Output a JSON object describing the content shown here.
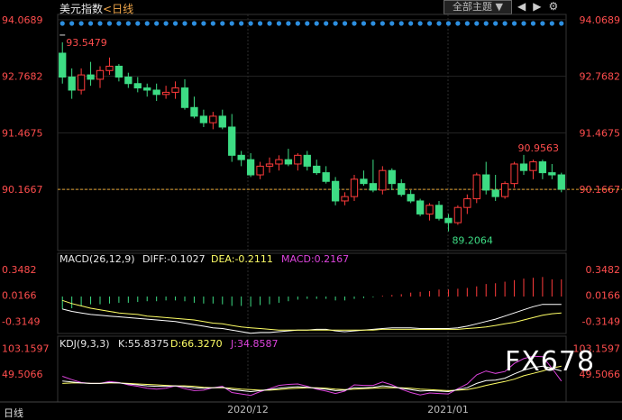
{
  "header": {
    "instrument": "美元指数",
    "period": "<日线",
    "theme_button": "全部主题 ▼",
    "bottom_tab": "日线",
    "watermark": "FX678",
    "nav_prev": "◀",
    "nav_next": "▶",
    "nav_settings": "⚙"
  },
  "chart_data": [
    {
      "type": "candlestick",
      "title": "美元指数",
      "yticks": [
        "94.0689",
        "92.7682",
        "91.4675",
        "90.1667"
      ],
      "ylim": [
        88.8,
        94.15
      ],
      "current_price": 90.1667,
      "annotations": {
        "high": "93.5479",
        "low": "89.2064",
        "recent_high": "90.9563"
      },
      "xticks": [
        "2020/12",
        "2021/01"
      ],
      "colors": {
        "up": "#ff3b3b",
        "down": "#3ddc84",
        "grid": "#2a2a2a",
        "price_line": "#e0a030"
      },
      "candles": [
        [
          93.3,
          93.55,
          92.6,
          92.75
        ],
        [
          92.75,
          92.95,
          92.25,
          92.45
        ],
        [
          92.45,
          92.95,
          92.35,
          92.8
        ],
        [
          92.8,
          93.1,
          92.55,
          92.7
        ],
        [
          92.7,
          93.0,
          92.5,
          92.9
        ],
        [
          92.9,
          93.2,
          92.8,
          93.0
        ],
        [
          93.0,
          93.05,
          92.65,
          92.75
        ],
        [
          92.75,
          92.85,
          92.5,
          92.6
        ],
        [
          92.6,
          92.75,
          92.4,
          92.5
        ],
        [
          92.5,
          92.6,
          92.3,
          92.45
        ],
        [
          92.45,
          92.6,
          92.2,
          92.35
        ],
        [
          92.35,
          92.55,
          92.25,
          92.4
        ],
        [
          92.4,
          92.65,
          92.25,
          92.5
        ],
        [
          92.5,
          92.7,
          92.0,
          92.05
        ],
        [
          92.05,
          92.3,
          91.8,
          91.85
        ],
        [
          91.85,
          92.0,
          91.6,
          91.7
        ],
        [
          91.7,
          91.95,
          91.55,
          91.85
        ],
        [
          91.85,
          92.0,
          91.55,
          91.6
        ],
        [
          91.6,
          91.9,
          90.8,
          90.95
        ],
        [
          90.95,
          91.05,
          90.7,
          90.85
        ],
        [
          90.85,
          91.0,
          90.45,
          90.5
        ],
        [
          90.5,
          90.8,
          90.4,
          90.7
        ],
        [
          90.7,
          90.9,
          90.55,
          90.75
        ],
        [
          90.75,
          90.95,
          90.6,
          90.85
        ],
        [
          90.85,
          91.1,
          90.7,
          90.75
        ],
        [
          90.75,
          91.0,
          90.6,
          90.95
        ],
        [
          90.95,
          91.05,
          90.6,
          90.7
        ],
        [
          90.7,
          90.85,
          90.5,
          90.55
        ],
        [
          90.55,
          90.7,
          90.3,
          90.35
        ],
        [
          90.35,
          90.45,
          89.8,
          89.9
        ],
        [
          89.9,
          90.1,
          89.8,
          90.0
        ],
        [
          90.0,
          90.5,
          89.9,
          90.4
        ],
        [
          90.4,
          90.6,
          90.25,
          90.3
        ],
        [
          90.3,
          90.85,
          90.1,
          90.15
        ],
        [
          90.15,
          90.7,
          90.05,
          90.6
        ],
        [
          90.6,
          90.65,
          90.15,
          90.3
        ],
        [
          90.3,
          90.4,
          90.0,
          90.05
        ],
        [
          90.05,
          90.15,
          89.85,
          89.9
        ],
        [
          89.9,
          89.95,
          89.55,
          89.6
        ],
        [
          89.6,
          89.85,
          89.45,
          89.8
        ],
        [
          89.8,
          89.9,
          89.45,
          89.5
        ],
        [
          89.5,
          89.6,
          89.2,
          89.4
        ],
        [
          89.4,
          89.8,
          89.35,
          89.75
        ],
        [
          89.75,
          90.05,
          89.6,
          89.95
        ],
        [
          89.95,
          90.55,
          89.85,
          90.5
        ],
        [
          90.5,
          90.8,
          90.05,
          90.15
        ],
        [
          90.15,
          90.5,
          89.9,
          90.0
        ],
        [
          90.0,
          90.35,
          89.95,
          90.3
        ],
        [
          90.3,
          90.8,
          90.2,
          90.75
        ],
        [
          90.75,
          90.96,
          90.5,
          90.6
        ],
        [
          90.6,
          90.85,
          90.4,
          90.8
        ],
        [
          90.8,
          90.85,
          90.4,
          90.55
        ],
        [
          90.55,
          90.75,
          90.4,
          90.5
        ],
        [
          90.5,
          90.55,
          90.1,
          90.17
        ]
      ]
    },
    {
      "type": "line",
      "title": "MACD(26,12,9)",
      "labels": {
        "diff": "DIFF:-0.1027",
        "dea": "DEA:-0.2111",
        "macd": "MACD:0.2167"
      },
      "yticks": [
        "0.3482",
        "0.0166",
        "-0.3149"
      ],
      "ylim": [
        -0.45,
        0.45
      ],
      "colors": {
        "diff": "#ffffff",
        "dea": "#ffff66",
        "hist_up": "#ff3b3b",
        "hist_down": "#3ddc84"
      },
      "hist": [
        -0.16,
        -0.15,
        -0.12,
        -0.1,
        -0.1,
        -0.09,
        -0.08,
        -0.08,
        -0.07,
        -0.06,
        -0.06,
        -0.05,
        -0.05,
        -0.06,
        -0.08,
        -0.09,
        -0.09,
        -0.1,
        -0.12,
        -0.12,
        -0.13,
        -0.11,
        -0.1,
        -0.08,
        -0.06,
        -0.04,
        -0.03,
        -0.03,
        -0.03,
        -0.05,
        -0.05,
        -0.03,
        -0.02,
        -0.01,
        0.01,
        0.02,
        0.03,
        0.05,
        0.06,
        0.07,
        0.09,
        0.09,
        0.1,
        0.11,
        0.13,
        0.16,
        0.17,
        0.19,
        0.21,
        0.23,
        0.24,
        0.25,
        0.22,
        0.22
      ],
      "diff": [
        -0.16,
        -0.19,
        -0.21,
        -0.23,
        -0.24,
        -0.25,
        -0.26,
        -0.27,
        -0.28,
        -0.29,
        -0.3,
        -0.31,
        -0.32,
        -0.34,
        -0.36,
        -0.38,
        -0.4,
        -0.41,
        -0.43,
        -0.45,
        -0.47,
        -0.46,
        -0.46,
        -0.45,
        -0.44,
        -0.43,
        -0.43,
        -0.42,
        -0.42,
        -0.44,
        -0.45,
        -0.44,
        -0.43,
        -0.42,
        -0.41,
        -0.4,
        -0.4,
        -0.4,
        -0.41,
        -0.41,
        -0.41,
        -0.41,
        -0.4,
        -0.38,
        -0.35,
        -0.32,
        -0.29,
        -0.25,
        -0.21,
        -0.17,
        -0.13,
        -0.1,
        -0.1,
        -0.1
      ],
      "dea": [
        -0.05,
        -0.09,
        -0.12,
        -0.15,
        -0.17,
        -0.19,
        -0.21,
        -0.22,
        -0.23,
        -0.25,
        -0.26,
        -0.27,
        -0.28,
        -0.29,
        -0.3,
        -0.32,
        -0.34,
        -0.35,
        -0.37,
        -0.39,
        -0.4,
        -0.41,
        -0.42,
        -0.43,
        -0.43,
        -0.43,
        -0.43,
        -0.43,
        -0.43,
        -0.43,
        -0.43,
        -0.43,
        -0.43,
        -0.43,
        -0.42,
        -0.42,
        -0.42,
        -0.42,
        -0.42,
        -0.42,
        -0.42,
        -0.42,
        -0.42,
        -0.41,
        -0.4,
        -0.39,
        -0.37,
        -0.35,
        -0.33,
        -0.3,
        -0.27,
        -0.24,
        -0.22,
        -0.21
      ]
    },
    {
      "type": "line",
      "title": "KDJ(9,3,3)",
      "labels": {
        "k": "K:55.8375",
        "d": "D:66.3270",
        "j": "J:34.8587"
      },
      "yticks": [
        "103.1597",
        "49.5066"
      ],
      "ylim": [
        -5,
        110
      ],
      "colors": {
        "k": "#ffffff",
        "d": "#ffff66",
        "j": "#dd44dd"
      },
      "k": [
        35,
        33,
        31,
        30,
        30,
        32,
        31,
        29,
        27,
        25,
        24,
        24,
        25,
        23,
        21,
        20,
        21,
        22,
        17,
        15,
        13,
        15,
        17,
        20,
        22,
        23,
        22,
        20,
        18,
        15,
        16,
        21,
        21,
        22,
        25,
        23,
        20,
        17,
        14,
        15,
        14,
        13,
        17,
        21,
        30,
        36,
        37,
        41,
        50,
        58,
        63,
        66,
        62,
        56
      ],
      "d": [
        30,
        31,
        31,
        30,
        30,
        31,
        31,
        30,
        29,
        28,
        27,
        26,
        25,
        25,
        24,
        22,
        21,
        21,
        20,
        18,
        17,
        16,
        16,
        17,
        19,
        20,
        21,
        21,
        20,
        18,
        17,
        18,
        19,
        20,
        21,
        21,
        21,
        20,
        18,
        17,
        16,
        15,
        16,
        17,
        21,
        26,
        30,
        34,
        39,
        46,
        51,
        56,
        62,
        66
      ],
      "j": [
        45,
        38,
        32,
        30,
        30,
        34,
        32,
        27,
        24,
        20,
        18,
        20,
        25,
        19,
        15,
        16,
        21,
        24,
        11,
        8,
        5,
        13,
        19,
        26,
        28,
        29,
        24,
        18,
        14,
        9,
        14,
        27,
        26,
        26,
        33,
        27,
        18,
        11,
        6,
        10,
        9,
        8,
        19,
        29,
        48,
        56,
        51,
        55,
        72,
        82,
        87,
        86,
        62,
        35
      ]
    }
  ]
}
